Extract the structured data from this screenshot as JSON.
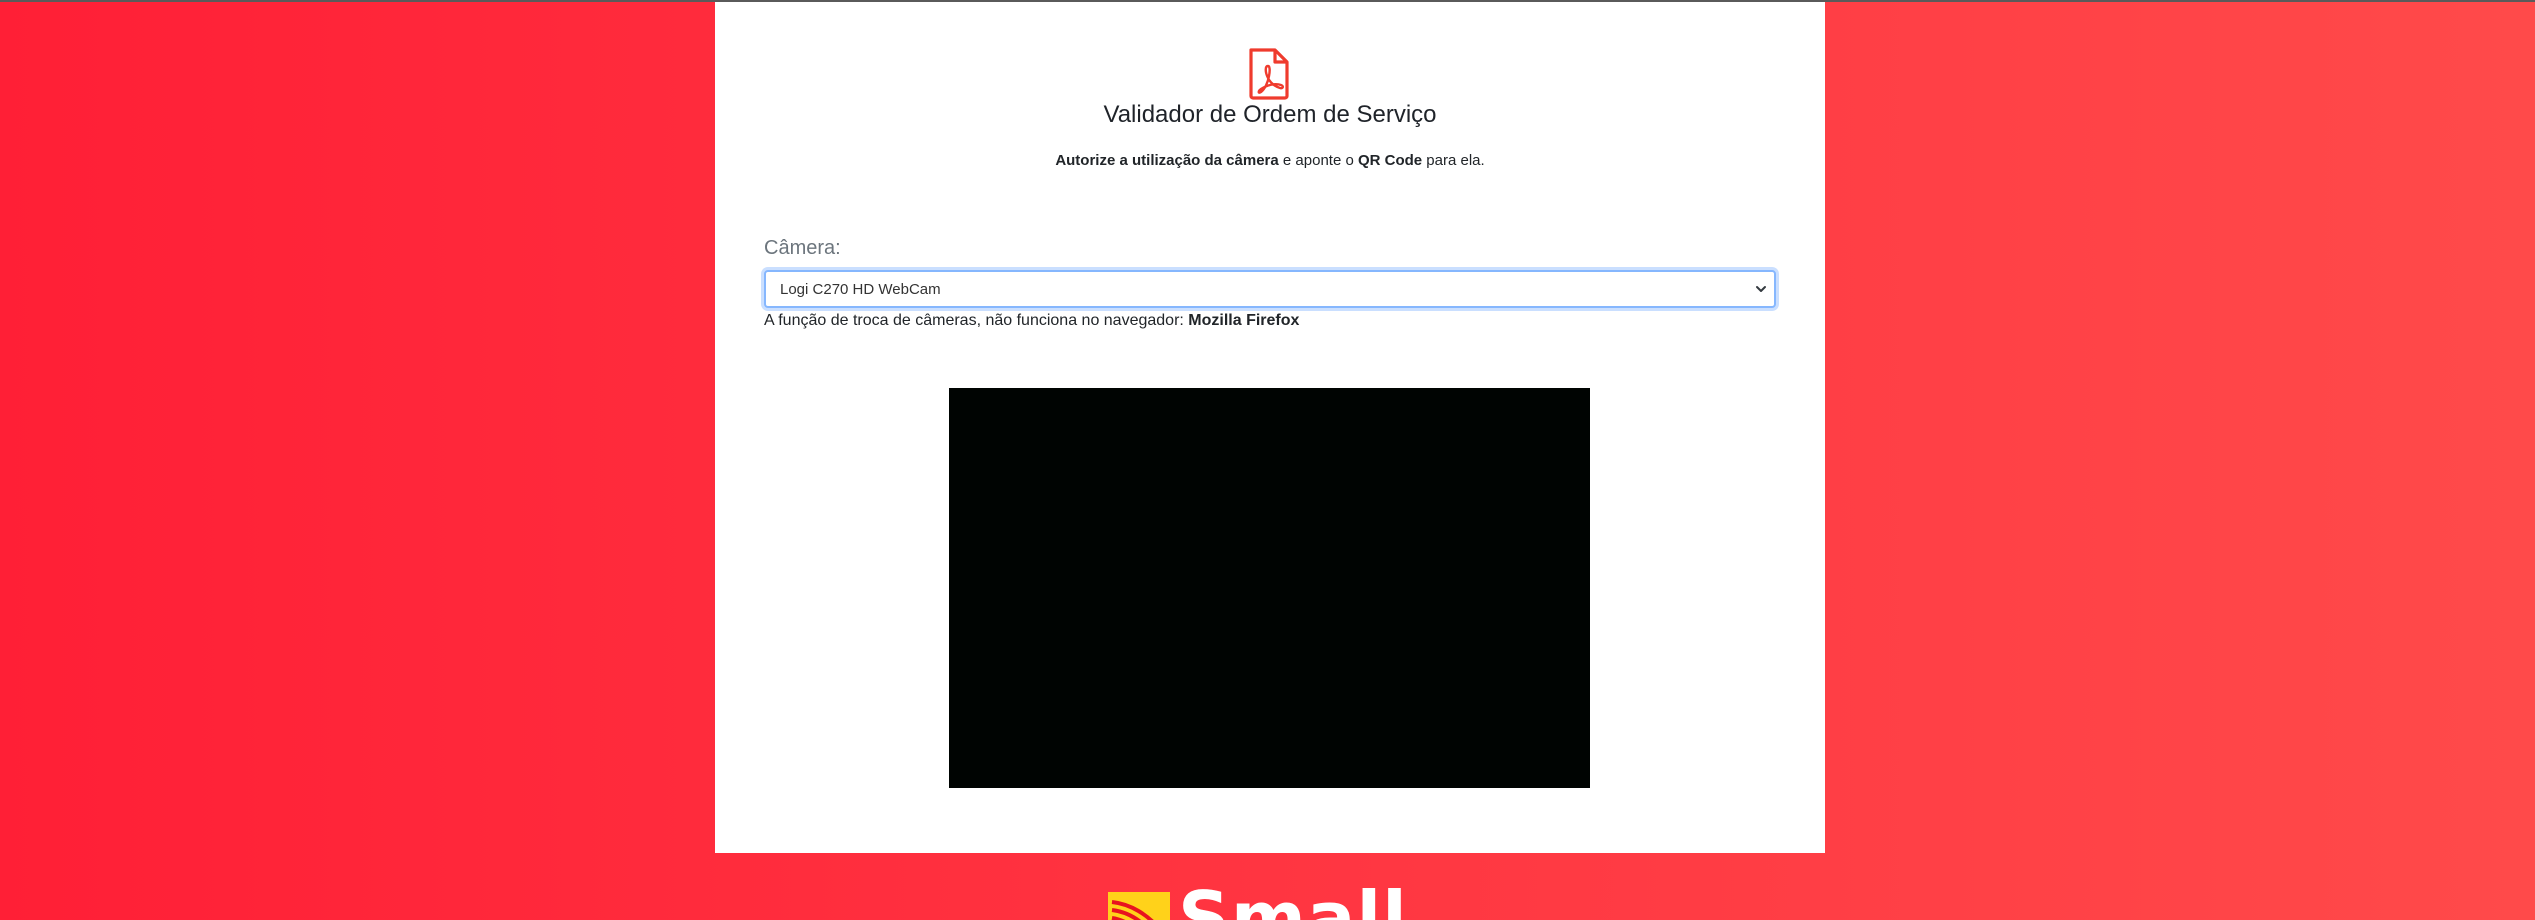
{
  "header": {
    "icon": "pdf-file-icon",
    "title": "Validador de Ordem de Serviço"
  },
  "instructions": {
    "part1_bold": "Autorize a utilização da câmera",
    "part2": " e aponte o ",
    "part3_bold": "QR Code",
    "part4": " para ela."
  },
  "camera": {
    "label": "Câmera:",
    "selected": "Logi C270 HD WebCam",
    "notice_text": "A função de troca de câmeras, não funciona no navegador: ",
    "notice_browser": "Mozilla Firefox"
  },
  "footer": {
    "logo_text": "Small"
  },
  "colors": {
    "background_start": "#ff1f36",
    "background_end": "#ff4a4a",
    "accent_red": "#ef3b2d",
    "card": "#ffffff",
    "video": "#000402"
  }
}
